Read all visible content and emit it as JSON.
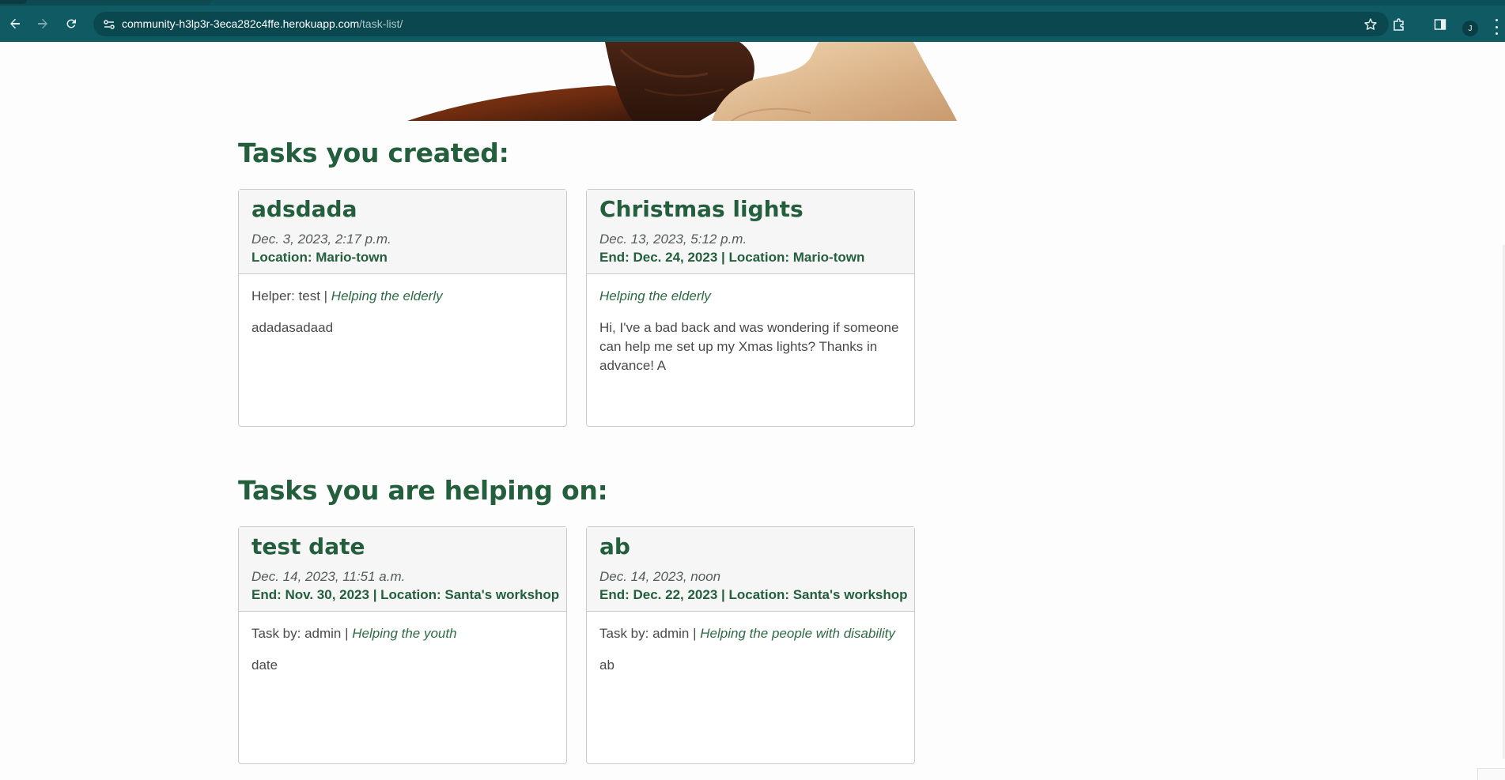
{
  "browser": {
    "url_host": "community-h3lp3r-3eca282c4ffe.herokuapp.com",
    "url_path": "/task-list/",
    "profile_initial": "J"
  },
  "sections": {
    "created_title": "Tasks you created:",
    "helping_title": "Tasks you are helping on:"
  },
  "created_tasks": [
    {
      "title": "adsdada",
      "date": "Dec. 3, 2023, 2:17 p.m.",
      "meta": "Location: Mario-town",
      "person_prefix": "Helper: test | ",
      "category": "Helping the elderly",
      "description": "adadasadaad"
    },
    {
      "title": "Christmas lights",
      "date": "Dec. 13, 2023, 5:12 p.m.",
      "meta": "End: Dec. 24, 2023 | Location: Mario-town",
      "person_prefix": "",
      "category": "Helping the elderly",
      "description": "Hi, I've a bad back and was wondering if someone can help me set up my Xmas lights? Thanks in advance! A"
    }
  ],
  "helping_tasks": [
    {
      "title": "test date",
      "date": "Dec. 14, 2023, 11:51 a.m.",
      "meta": "End: Nov. 30, 2023 | Location: Santa's workshop",
      "person_prefix": "Task by: admin | ",
      "category": "Helping the youth",
      "description": "date"
    },
    {
      "title": "ab",
      "date": "Dec. 14, 2023, noon",
      "meta": "End: Dec. 22, 2023 | Location: Santa's workshop",
      "person_prefix": "Task by: admin | ",
      "category": "Helping the people with disability",
      "description": "ab"
    }
  ],
  "colors": {
    "brand_green": "#235f3c",
    "chrome_teal": "#0f5a63"
  }
}
